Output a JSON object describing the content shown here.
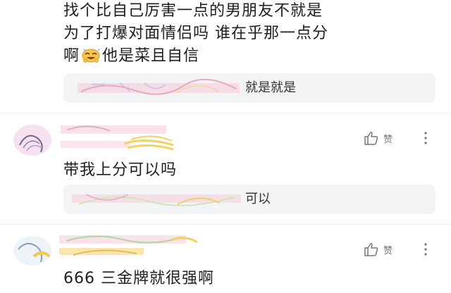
{
  "comments": [
    {
      "text_lines": [
        "找个比自己厉害一点的男朋友不就是",
        "为了打爆对面情侣吗 谁在乎那一点分",
        "他是菜且自信"
      ],
      "line3_prefix": "啊",
      "reply": {
        "text": "就是就是"
      }
    },
    {
      "text": "带我上分可以吗",
      "like_label": "赞",
      "reply": {
        "text": "可以"
      }
    },
    {
      "text": "666 三金牌就很强啊",
      "like_label": "赞"
    }
  ],
  "icons": {
    "like": "thumbs-up-icon",
    "more": "vertical-dots-icon",
    "emoji": "laughing-sweat-emoji"
  },
  "colors": {
    "reply_bg": "#f3f4f6",
    "text": "#1e1e1e",
    "muted": "#777777",
    "redaction_pink": "#f6c6d6",
    "redaction_yellow": "#f2c94c"
  }
}
